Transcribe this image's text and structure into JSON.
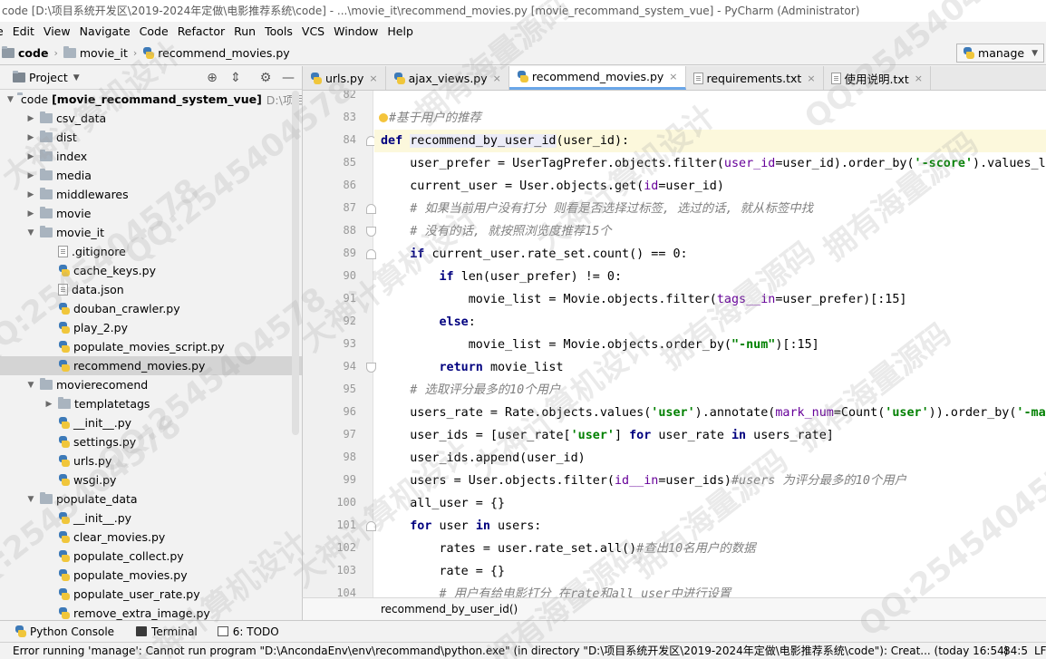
{
  "window": {
    "title": "code [D:\\项目系统开发区\\2019-2024年定做\\电影推荐系统\\code] - ...\\movie_it\\recommend_movies.py [movie_recommand_system_vue] - PyCharm (Administrator)"
  },
  "menu": [
    "e",
    "Edit",
    "View",
    "Navigate",
    "Code",
    "Refactor",
    "Run",
    "Tools",
    "VCS",
    "Window",
    "Help"
  ],
  "navbar": {
    "crumbs": [
      "code",
      "movie_it",
      "recommend_movies.py"
    ],
    "run_config": "manage"
  },
  "project_panel": {
    "title": "Project",
    "tree": [
      {
        "label": "code",
        "bold_suffix": "[movie_recommand_system_vue]",
        "hint": "D:\\项目系",
        "depth": 0,
        "kind": "folder",
        "expanded": true
      },
      {
        "label": "csv_data",
        "depth": 1,
        "kind": "folder",
        "expanded": false
      },
      {
        "label": "dist",
        "depth": 1,
        "kind": "folder",
        "expanded": false
      },
      {
        "label": "index",
        "depth": 1,
        "kind": "folder",
        "expanded": false
      },
      {
        "label": "media",
        "depth": 1,
        "kind": "folder",
        "expanded": false
      },
      {
        "label": "middlewares",
        "depth": 1,
        "kind": "folder",
        "expanded": false
      },
      {
        "label": "movie",
        "depth": 1,
        "kind": "folder",
        "expanded": false
      },
      {
        "label": "movie_it",
        "depth": 1,
        "kind": "folder",
        "expanded": true
      },
      {
        "label": ".gitignore",
        "depth": 2,
        "kind": "text"
      },
      {
        "label": "cache_keys.py",
        "depth": 2,
        "kind": "py"
      },
      {
        "label": "data.json",
        "depth": 2,
        "kind": "text"
      },
      {
        "label": "douban_crawler.py",
        "depth": 2,
        "kind": "py"
      },
      {
        "label": "play_2.py",
        "depth": 2,
        "kind": "py"
      },
      {
        "label": "populate_movies_script.py",
        "depth": 2,
        "kind": "py"
      },
      {
        "label": "recommend_movies.py",
        "depth": 2,
        "kind": "py",
        "selected": true
      },
      {
        "label": "movierecomend",
        "depth": 1,
        "kind": "folder",
        "expanded": true
      },
      {
        "label": "templatetags",
        "depth": 2,
        "kind": "folder",
        "expanded": false
      },
      {
        "label": "__init__.py",
        "depth": 2,
        "kind": "py"
      },
      {
        "label": "settings.py",
        "depth": 2,
        "kind": "py"
      },
      {
        "label": "urls.py",
        "depth": 2,
        "kind": "py"
      },
      {
        "label": "wsgi.py",
        "depth": 2,
        "kind": "py"
      },
      {
        "label": "populate_data",
        "depth": 1,
        "kind": "folder",
        "expanded": true
      },
      {
        "label": "__init__.py",
        "depth": 2,
        "kind": "py"
      },
      {
        "label": "clear_movies.py",
        "depth": 2,
        "kind": "py"
      },
      {
        "label": "populate_collect.py",
        "depth": 2,
        "kind": "py"
      },
      {
        "label": "populate_movies.py",
        "depth": 2,
        "kind": "py"
      },
      {
        "label": "populate_user_rate.py",
        "depth": 2,
        "kind": "py"
      },
      {
        "label": "remove_extra_image.py",
        "depth": 2,
        "kind": "py"
      }
    ]
  },
  "tabs": [
    {
      "label": "urls.py",
      "kind": "py",
      "active": false
    },
    {
      "label": "ajax_views.py",
      "kind": "py",
      "active": false
    },
    {
      "label": "recommend_movies.py",
      "kind": "py",
      "active": true
    },
    {
      "label": "requirements.txt",
      "kind": "text",
      "active": false
    },
    {
      "label": "使用说明.txt",
      "kind": "text",
      "active": false
    }
  ],
  "editor": {
    "current_line": 84,
    "lines": [
      {
        "n": 82,
        "tokens": []
      },
      {
        "n": 83,
        "tokens": [
          [
            "cm",
            "#基于用户的推荐"
          ]
        ]
      },
      {
        "n": 84,
        "tokens": [
          [
            "kw",
            "def "
          ],
          [
            "fn",
            "recommend_by_user_id"
          ],
          [
            "",
            "(user_id):"
          ]
        ]
      },
      {
        "n": 85,
        "tokens": [
          [
            "",
            "    user_prefer = UserTagPrefer.objects.filter("
          ],
          [
            "kwarg",
            "user_id"
          ],
          [
            "",
            "=user_id).order_by("
          ],
          [
            "str",
            "'-score'"
          ],
          [
            "",
            ").values_list"
          ]
        ]
      },
      {
        "n": 86,
        "tokens": [
          [
            "",
            "    current_user = User.objects.get("
          ],
          [
            "kwarg",
            "id"
          ],
          [
            "",
            "=user_id)"
          ]
        ]
      },
      {
        "n": 87,
        "tokens": [
          [
            "cm",
            "    # 如果当前用户没有打分 则看是否选择过标签, 选过的话, 就从标签中找"
          ]
        ]
      },
      {
        "n": 88,
        "tokens": [
          [
            "cm",
            "    # 没有的话, 就按照浏览度推荐15个"
          ]
        ]
      },
      {
        "n": 89,
        "tokens": [
          [
            "kw",
            "    if "
          ],
          [
            "",
            "current_user.rate_set.count() == 0:"
          ]
        ]
      },
      {
        "n": 90,
        "tokens": [
          [
            "kw",
            "        if "
          ],
          [
            "",
            "len(user_prefer) != 0:"
          ]
        ]
      },
      {
        "n": 91,
        "tokens": [
          [
            "",
            "            movie_list = Movie.objects.filter("
          ],
          [
            "kwarg",
            "tags__in"
          ],
          [
            "",
            "=user_prefer)[:15]"
          ]
        ]
      },
      {
        "n": 92,
        "tokens": [
          [
            "kw",
            "        else"
          ],
          [
            "",
            ":"
          ]
        ]
      },
      {
        "n": 93,
        "tokens": [
          [
            "",
            "            movie_list = Movie.objects.order_by("
          ],
          [
            "str",
            "\"-num\""
          ],
          [
            "",
            ")[:15]"
          ]
        ]
      },
      {
        "n": 94,
        "tokens": [
          [
            "kw",
            "        return "
          ],
          [
            "",
            "movie_list"
          ]
        ]
      },
      {
        "n": 95,
        "tokens": [
          [
            "cm",
            "    # 选取评分最多的10个用户"
          ]
        ]
      },
      {
        "n": 96,
        "tokens": [
          [
            "",
            "    users_rate = Rate.objects.values("
          ],
          [
            "str",
            "'user'"
          ],
          [
            "",
            ").annotate("
          ],
          [
            "kwarg",
            "mark_num"
          ],
          [
            "",
            "=Count("
          ],
          [
            "str",
            "'user'"
          ],
          [
            "",
            ")).order_by("
          ],
          [
            "str",
            "'-mark"
          ]
        ]
      },
      {
        "n": 97,
        "tokens": [
          [
            "",
            "    user_ids = [user_rate["
          ],
          [
            "str",
            "'user'"
          ],
          [
            "",
            "] "
          ],
          [
            "kw",
            "for "
          ],
          [
            "",
            "user_rate "
          ],
          [
            "kw",
            "in "
          ],
          [
            "",
            "users_rate]"
          ]
        ]
      },
      {
        "n": 98,
        "tokens": [
          [
            "",
            "    user_ids.append(user_id)"
          ]
        ]
      },
      {
        "n": 99,
        "tokens": [
          [
            "",
            "    users = User.objects.filter("
          ],
          [
            "kwarg",
            "id__in"
          ],
          [
            "",
            "=user_ids)"
          ],
          [
            "cm",
            "#users 为评分最多的10个用户"
          ]
        ]
      },
      {
        "n": 100,
        "tokens": [
          [
            "",
            "    all_user = {}"
          ]
        ]
      },
      {
        "n": 101,
        "tokens": [
          [
            "kw",
            "    for "
          ],
          [
            "",
            "user "
          ],
          [
            "kw",
            "in "
          ],
          [
            "",
            "users:"
          ]
        ]
      },
      {
        "n": 102,
        "tokens": [
          [
            "",
            "        rates = user.rate_set.all()"
          ],
          [
            "cm",
            "#查出10名用户的数据"
          ]
        ]
      },
      {
        "n": 103,
        "tokens": [
          [
            "",
            "        rate = {}"
          ]
        ]
      },
      {
        "n": 104,
        "tokens": [
          [
            "cm",
            "        # 用户有给电影打分 在rate和all_user中进行设置"
          ]
        ]
      }
    ],
    "breadcrumb": "recommend_by_user_id()"
  },
  "toolwindows": [
    "Python Console",
    "Terminal",
    "6: TODO"
  ],
  "status": {
    "message": "Error running 'manage': Cannot run program \"D:\\AncondaEnv\\env\\recommand\\python.exe\" (in directory \"D:\\项目系统开发区\\2019-2024年定做\\电影推荐系统\\code\"): Creat... (today 16:54)",
    "position": "84:5",
    "line_sep": "LF"
  },
  "watermark": {
    "phrases": [
      "QQ:2545404578",
      "大神计算机设计",
      "拥有海量源码"
    ]
  }
}
